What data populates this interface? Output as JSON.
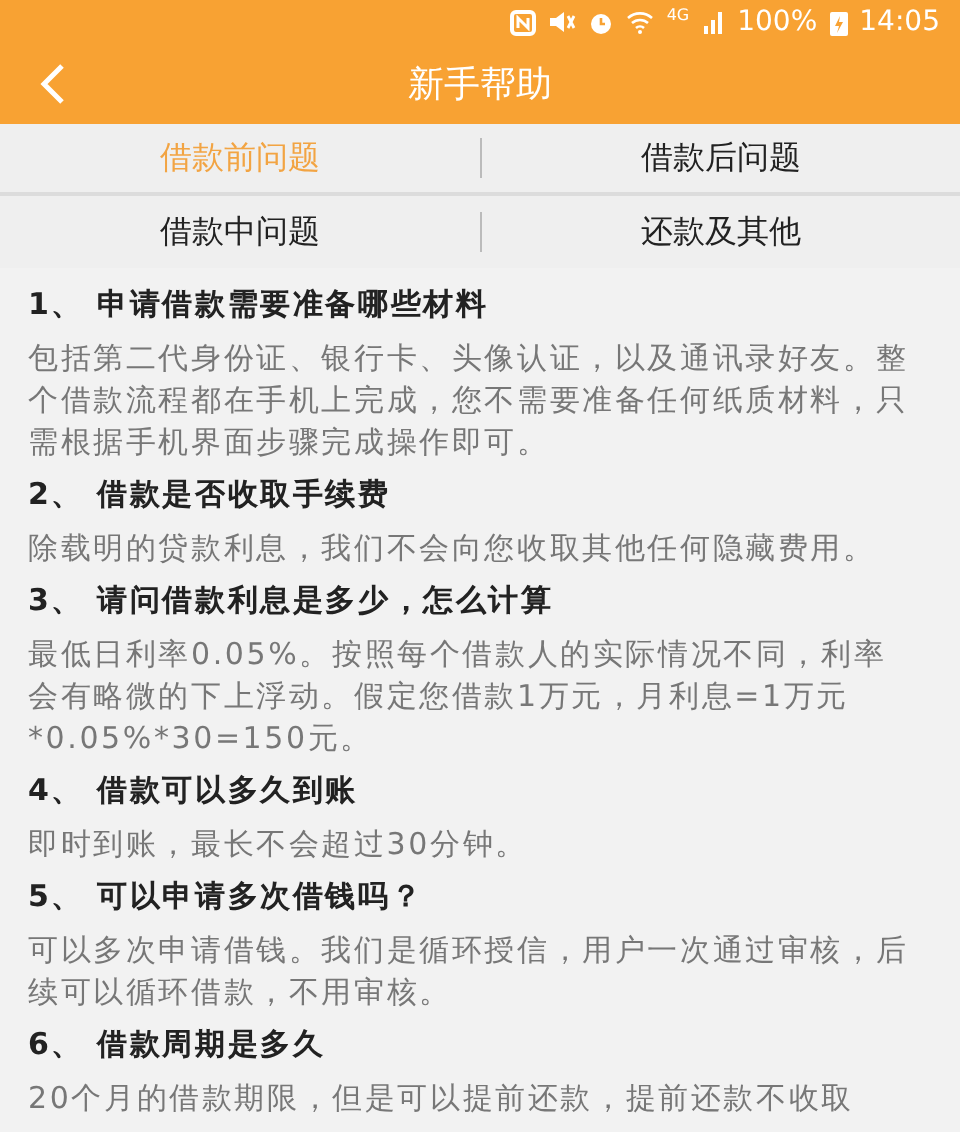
{
  "status_bar": {
    "battery": "100%",
    "time": "14:05",
    "network": "4G"
  },
  "header": {
    "title": "新手帮助"
  },
  "tabs": [
    {
      "label": "借款前问题",
      "selected": true
    },
    {
      "label": "借款后问题",
      "selected": false
    },
    {
      "label": "借款中问题",
      "selected": false
    },
    {
      "label": "还款及其他",
      "selected": false
    }
  ],
  "faq": [
    {
      "question": "1、 申请借款需要准备哪些材料",
      "answer": "包括第二代身份证、银行卡、头像认证，以及通讯录好友。整个借款流程都在手机上完成，您不需要准备任何纸质材料，只需根据手机界面步骤完成操作即可。"
    },
    {
      "question": "2、 借款是否收取手续费",
      "answer": "除载明的贷款利息，我们不会向您收取其他任何隐藏费用。"
    },
    {
      "question": "3、 请问借款利息是多少，怎么计算",
      "answer": "最低日利率0.05%。按照每个借款人的实际情况不同，利率会有略微的下上浮动。假定您借款1万元，月利息=1万元*0.05%*30=150元。"
    },
    {
      "question": "4、 借款可以多久到账",
      "answer": "即时到账，最长不会超过30分钟。"
    },
    {
      "question": "5、 可以申请多次借钱吗？",
      "answer": "可以多次申请借钱。我们是循环授信，用户一次通过审核，后续可以循环借款，不用审核。"
    },
    {
      "question": "6、 借款周期是多久",
      "answer": "20个月的借款期限，但是可以提前还款，提前还款不收取"
    }
  ]
}
